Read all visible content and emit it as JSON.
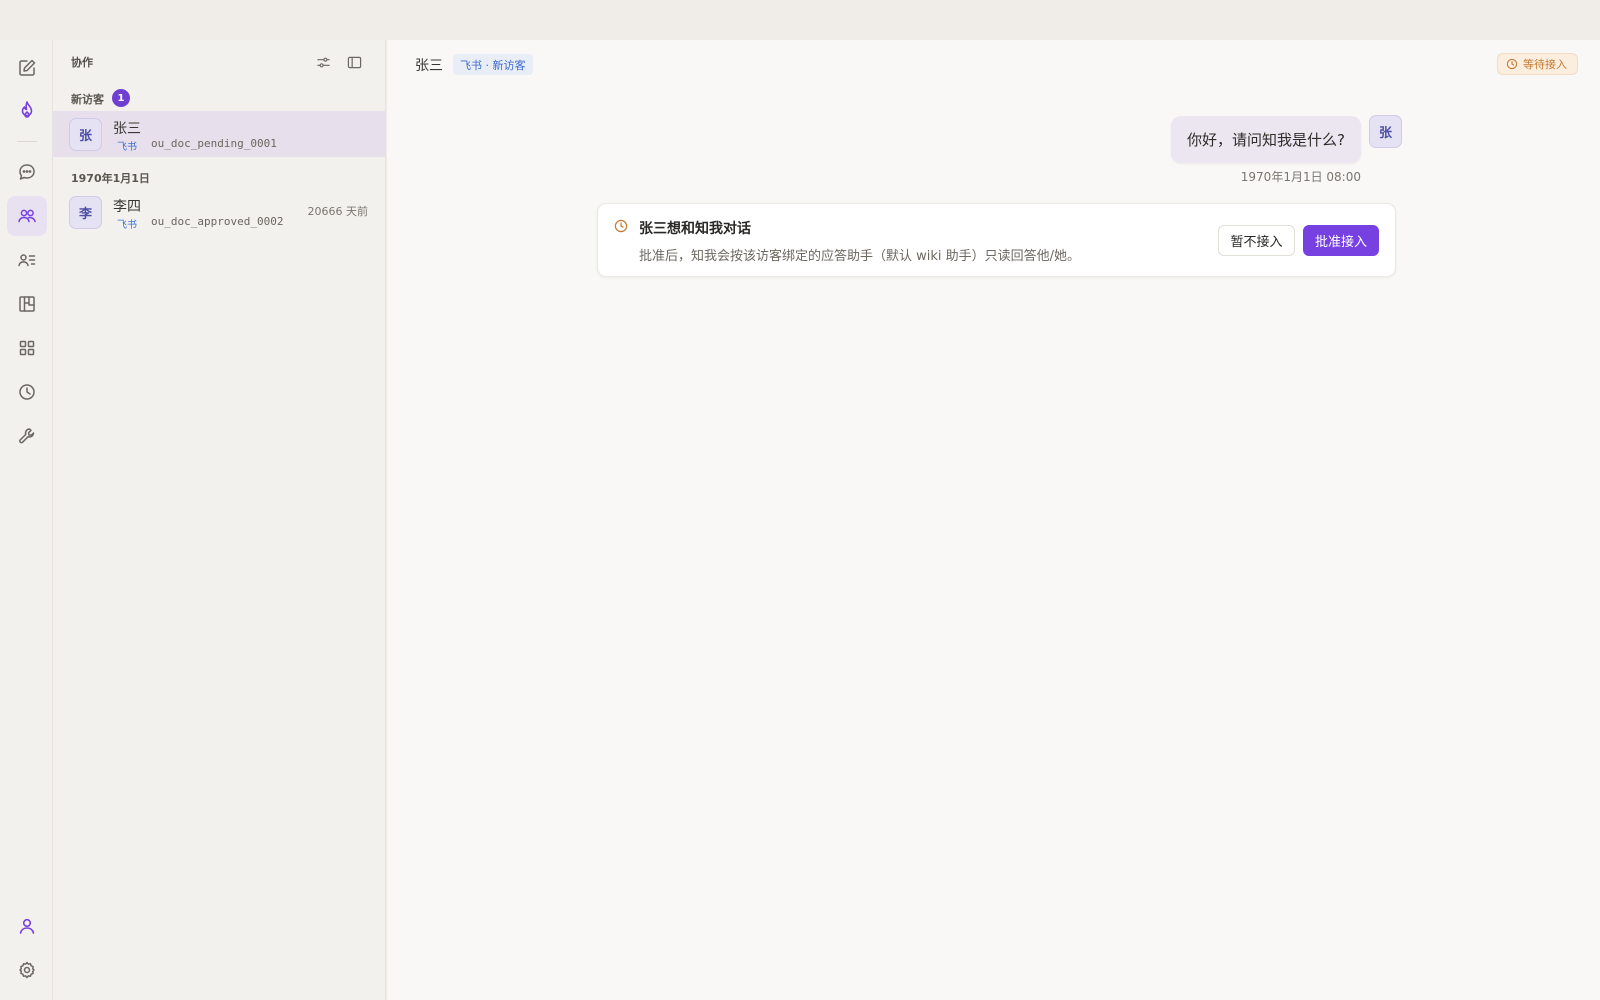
{
  "colors": {
    "accent": "#7641e0",
    "badge": "#6f3fd1",
    "selected_row": "#e7e0ec",
    "link_blue": "#3c6bcf",
    "warning": "#c47a30"
  },
  "rail": {
    "icons": [
      "edit-icon",
      "flame-icon",
      "chat-icon",
      "users-icon",
      "contacts-icon",
      "board-icon",
      "grid-icon",
      "clock-icon",
      "wrench-icon",
      "user-icon",
      "gear-icon"
    ],
    "active": "users-icon"
  },
  "sidebar": {
    "title": "协作",
    "sections": [
      {
        "label": "新访客",
        "badge": "1",
        "items": [
          {
            "avatar": "张",
            "name": "张三",
            "tag": "飞书",
            "id": "ou_doc_pending_0001",
            "time": ""
          }
        ]
      },
      {
        "label": "1970年1月1日",
        "items": [
          {
            "avatar": "李",
            "name": "李四",
            "tag": "飞书",
            "id": "ou_doc_approved_0002",
            "time": "20666 天前"
          }
        ]
      }
    ]
  },
  "main": {
    "header": {
      "name": "张三",
      "tag": "飞书 · 新访客",
      "status": "等待接入"
    },
    "message": {
      "text": "你好，请问知我是什么?",
      "avatar": "张",
      "time": "1970年1月1日 08:00"
    },
    "request_card": {
      "title": "张三想和知我对话",
      "description": "批准后，知我会按该访客绑定的应答助手（默认 wiki 助手）只读回答他/她。",
      "skip_label": "暂不接入",
      "approve_label": "批准接入"
    }
  }
}
